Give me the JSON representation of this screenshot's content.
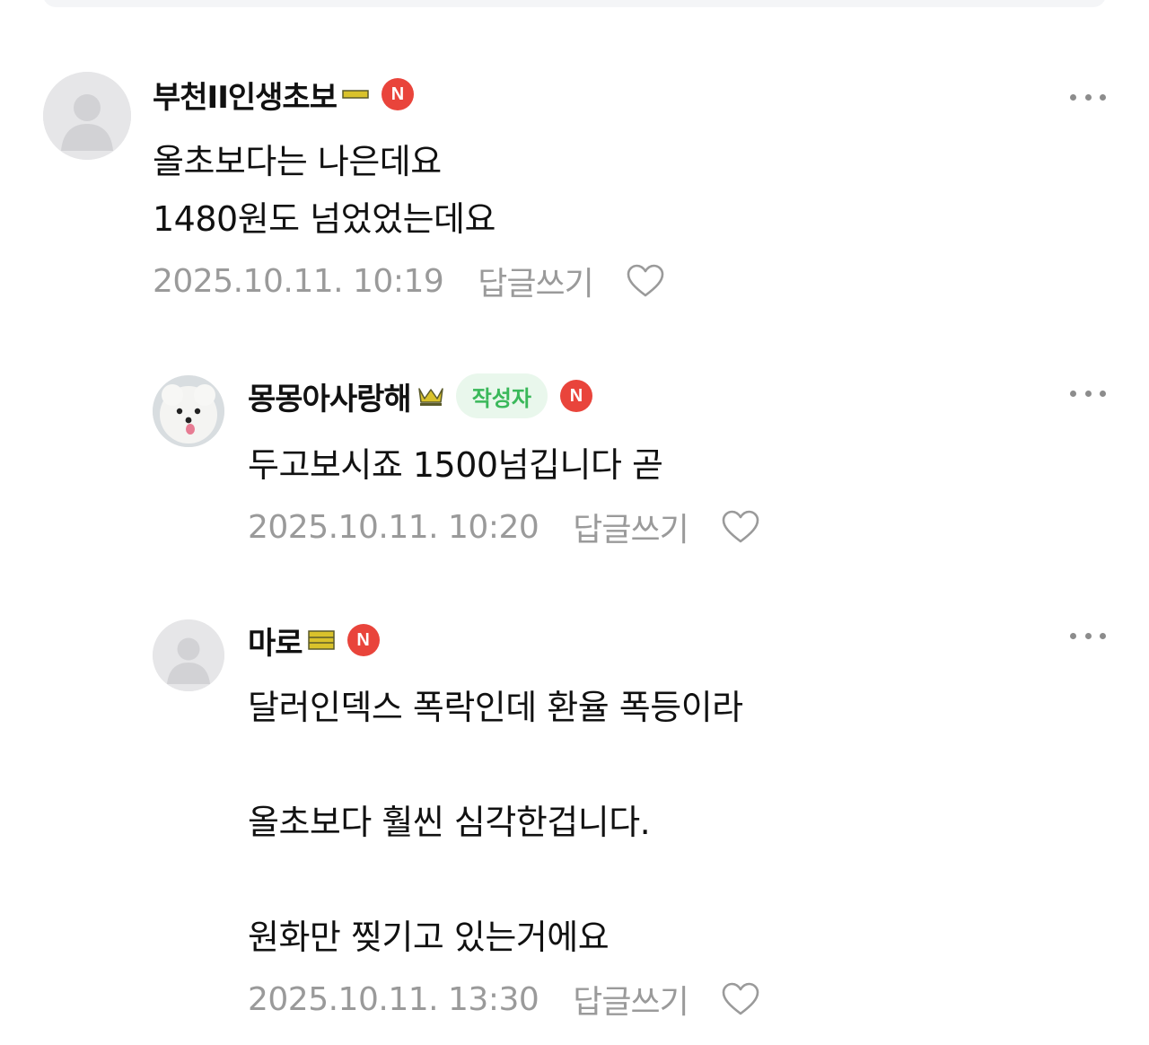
{
  "comments": [
    {
      "nickname": "부천II인생초보",
      "grade_icon": "grade-bar-icon",
      "n_badge": "N",
      "body": "올초보다는 나은데요\n1480원도 넘었었는데요",
      "date": "2025.10.11. 10:19",
      "reply_label": "답글쓰기",
      "avatar": "default-avatar"
    },
    {
      "nickname": "몽몽아사랑해",
      "grade_icon": "crown-icon",
      "author_tag": "작성자",
      "n_badge": "N",
      "body": "두고보시죠 1500넘깁니다 곧",
      "date": "2025.10.11. 10:20",
      "reply_label": "답글쓰기",
      "avatar": "dog-avatar"
    },
    {
      "nickname": "마로",
      "grade_icon": "grade-stack-icon",
      "n_badge": "N",
      "body": "달러인덱스 폭락인데 환율 폭등이라\n\n올초보다 훨씬 심각한겁니다.\n\n원화만 찢기고 있는거에요",
      "date": "2025.10.11. 13:30",
      "reply_label": "답글쓰기",
      "avatar": "default-avatar"
    }
  ],
  "colors": {
    "n_badge": "#e9443b",
    "author_tag_bg": "#e9f7ec",
    "author_tag_text": "#3ab85a",
    "meta_text": "#9a9a9a",
    "grade_yellow": "#d9c22b"
  }
}
